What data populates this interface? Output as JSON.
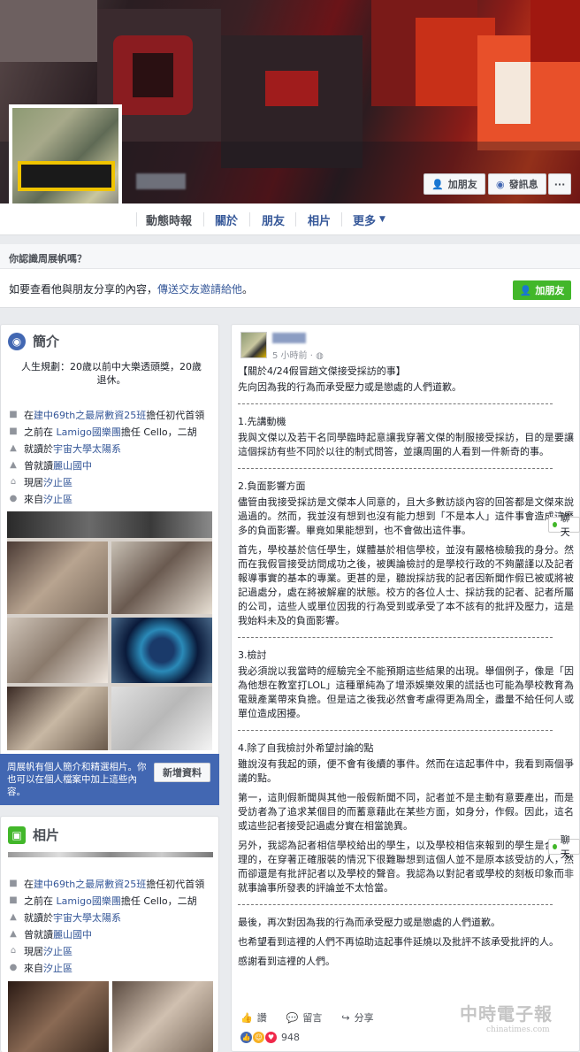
{
  "cover": {
    "add_friend_label": "加朋友",
    "message_label": "發訊息",
    "more_label": "···"
  },
  "nav": {
    "tabs": [
      "動態時報",
      "關於",
      "朋友",
      "相片",
      "更多"
    ]
  },
  "friend_prompt": {
    "title": "你認識周展帆嗎？",
    "text": "如要查看他與朋友分享的內容，",
    "link": "傳送交友邀請給他",
    "text_end": "。",
    "button": "加朋友"
  },
  "intro": {
    "title": "簡介",
    "bio": "人生規劃：20歲以前中大樂透頭獎，20歲退休。",
    "items": [
      {
        "icon": "briefcase-icon",
        "prefix": "在",
        "link": "建中69th之最屌數資25班",
        "suffix": "擔任初代首領"
      },
      {
        "icon": "briefcase-icon",
        "prefix": "之前在 ",
        "link": "Lamigo國樂團",
        "suffix": "擔任 Cello，二胡"
      },
      {
        "icon": "graduation-cap-icon",
        "prefix": "就讀於",
        "link": "宇宙大學太陽系",
        "suffix": ""
      },
      {
        "icon": "graduation-cap-icon",
        "prefix": "曾就讀",
        "link": "麗山國中",
        "suffix": ""
      },
      {
        "icon": "home-icon",
        "prefix": "現居",
        "link": "汐止區",
        "suffix": ""
      },
      {
        "icon": "location-pin-icon",
        "prefix": "來自",
        "link": "汐止區",
        "suffix": ""
      }
    ],
    "featured_text": "周展帆有個人簡介和精選相片。你也可以在個人檔案中加上這些內容。",
    "featured_button": "新增資料"
  },
  "photos": {
    "title": "相片",
    "items": [
      {
        "icon": "briefcase-icon",
        "prefix": "在",
        "link": "建中69th之最屌數資25班",
        "suffix": "擔任初代首領"
      },
      {
        "icon": "briefcase-icon",
        "prefix": "之前在 ",
        "link": "Lamigo國樂團",
        "suffix": "擔任 Cello，二胡"
      },
      {
        "icon": "graduation-cap-icon",
        "prefix": "就讀於",
        "link": "宇宙大學太陽系",
        "suffix": ""
      },
      {
        "icon": "graduation-cap-icon",
        "prefix": "曾就讀",
        "link": "麗山國中",
        "suffix": ""
      },
      {
        "icon": "home-icon",
        "prefix": "現居",
        "link": "汐止區",
        "suffix": ""
      },
      {
        "icon": "location-pin-icon",
        "prefix": "來自",
        "link": "汐止區",
        "suffix": ""
      }
    ]
  },
  "post": {
    "time": "5 小時前 · ",
    "title": "【關於4/24假冒趙文傑接受採訪的事】",
    "intro": "先向因為我的行為而承受壓力或是戀處的人們道歉。",
    "sec1_title": "1.先講動機",
    "sec1_p1": "我與文傑以及若干名同學臨時起意讓我穿著文傑的制服接受採訪，目的是要讓這個採訪有些不同於以往的制式問答，並讓周圍的人看到一件新奇的事。",
    "sec2_title": "2.負面影響方面",
    "sec2_p1": "儘管由我接受採訪是文傑本人同意的，且大多數訪談內容的回答都是文傑來說過過的。然而，我並沒有想到也沒有能力想到「不是本人」這件事會造成這麼多的負面影響。畢竟如果能想到，也不會做出這件事。",
    "sec2_p2": "首先，學校基於信任學生，媒體基於相信學校，並沒有嚴格檢驗我的身分。然而在我假冒接受訪問成功之後，被輿論檢討的是學校行政的不夠嚴謹以及記者報導事實的基本的專業。更甚的是，聽說採訪我的記者因新聞作假已被或將被記過處分，處在將被解雇的狀態。校方的各位人士、採訪我的記者、記者所屬的公司，這些人或單位因我的行為受到或承受了本不該有的批評及壓力，這是我始料未及的負面影響。",
    "sec3_title": "3.檢討",
    "sec3_p1": "我必須說以我當時的經驗完全不能預期這些結果的出現。舉個例子，像是「因為他想在教室打LOL」這種單純為了增添娛樂效果的謊話也可能為學校教育為電競產業帶來負擔。但是這之後我必然會考慮得更為周全，盡量不給任何人或單位造成困擾。",
    "sec4_title": "4.除了自我檢討外希望討論的點",
    "sec4_p1": "雖說沒有我起的頭，便不會有後續的事件。然而在這起事件中，我看到兩個爭議的點。",
    "sec4_p2": "第一，這則假新聞與其他一般假新聞不同，記者並不是主動有意要產出，而是受訪者為了追求某個目的而蓄意藉此在某些方面，如身分，作假。因此，這名或這些記者接受記過處分實在相當詭異。",
    "sec4_p3": "另外，我認為記者相信學校給出的學生，以及學校相信來報到的學生是合乎情理的，在穿著正確服裝的情況下很難聯想到這個人並不是原本該受訪的人，然而卻還是有批評記者以及學校的聲音。我認為以對記者或學校的刻板印象而非就事論事所發表的評論並不太恰當。",
    "outro_p1": "最後，再次對因為我的行為而承受壓力或是戀處的人們道歉。",
    "outro_p2": "也希望看到這裡的人們不再協助這起事件延燒以及批評不該承受批評的人。",
    "outro_p3": "感謝看到這裡的人們。",
    "like_label": "讚",
    "comment_label": "留言",
    "share_label": "分享",
    "reactions_count": "948"
  },
  "chat": {
    "label": "聊天"
  },
  "watermark": {
    "big": "中時電子報",
    "small": "chinatimes.com"
  }
}
